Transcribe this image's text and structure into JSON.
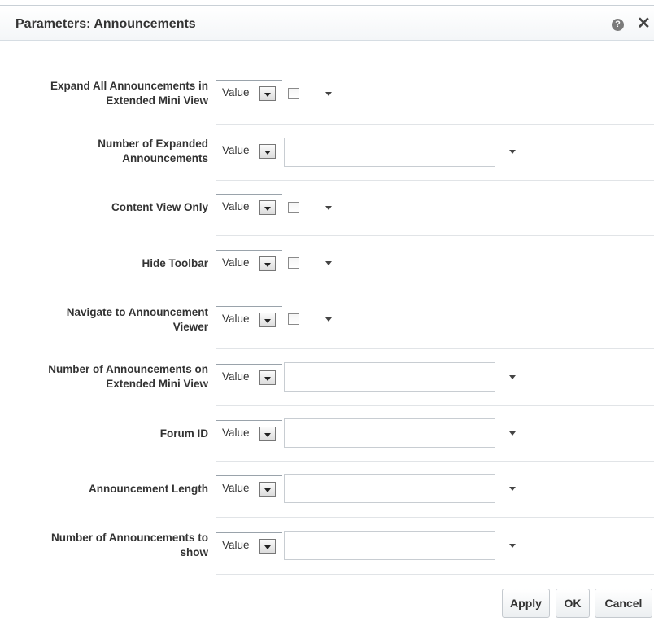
{
  "dialog": {
    "title": "Parameters: Announcements",
    "help_icon": "help-icon",
    "close_icon": "close-icon",
    "help_glyph": "?",
    "close_glyph": "✕"
  },
  "params": [
    {
      "label_line1": "Expand All Announcements in",
      "label_line2": "Extended Mini View",
      "mode": "Value",
      "input": "checkbox",
      "checked": false
    },
    {
      "label_line1": "Number of Expanded",
      "label_line2": "Announcements",
      "mode": "Value",
      "input": "text",
      "value": ""
    },
    {
      "label_line1": "Content View Only",
      "label_line2": "",
      "mode": "Value",
      "input": "checkbox",
      "checked": false
    },
    {
      "label_line1": "Hide Toolbar",
      "label_line2": "",
      "mode": "Value",
      "input": "checkbox",
      "checked": false
    },
    {
      "label_line1": "Navigate to Announcement",
      "label_line2": "Viewer",
      "mode": "Value",
      "input": "checkbox",
      "checked": false
    },
    {
      "label_line1": "Number of Announcements on",
      "label_line2": "Extended Mini View",
      "mode": "Value",
      "input": "text",
      "value": ""
    },
    {
      "label_line1": "Forum ID",
      "label_line2": "",
      "mode": "Value",
      "input": "text",
      "value": ""
    },
    {
      "label_line1": "Announcement Length",
      "label_line2": "",
      "mode": "Value",
      "input": "text",
      "value": ""
    },
    {
      "label_line1": "Number of Announcements to",
      "label_line2": "show",
      "mode": "Value",
      "input": "text",
      "value": ""
    }
  ],
  "buttons": {
    "apply": "Apply",
    "ok": "OK",
    "cancel": "Cancel"
  }
}
